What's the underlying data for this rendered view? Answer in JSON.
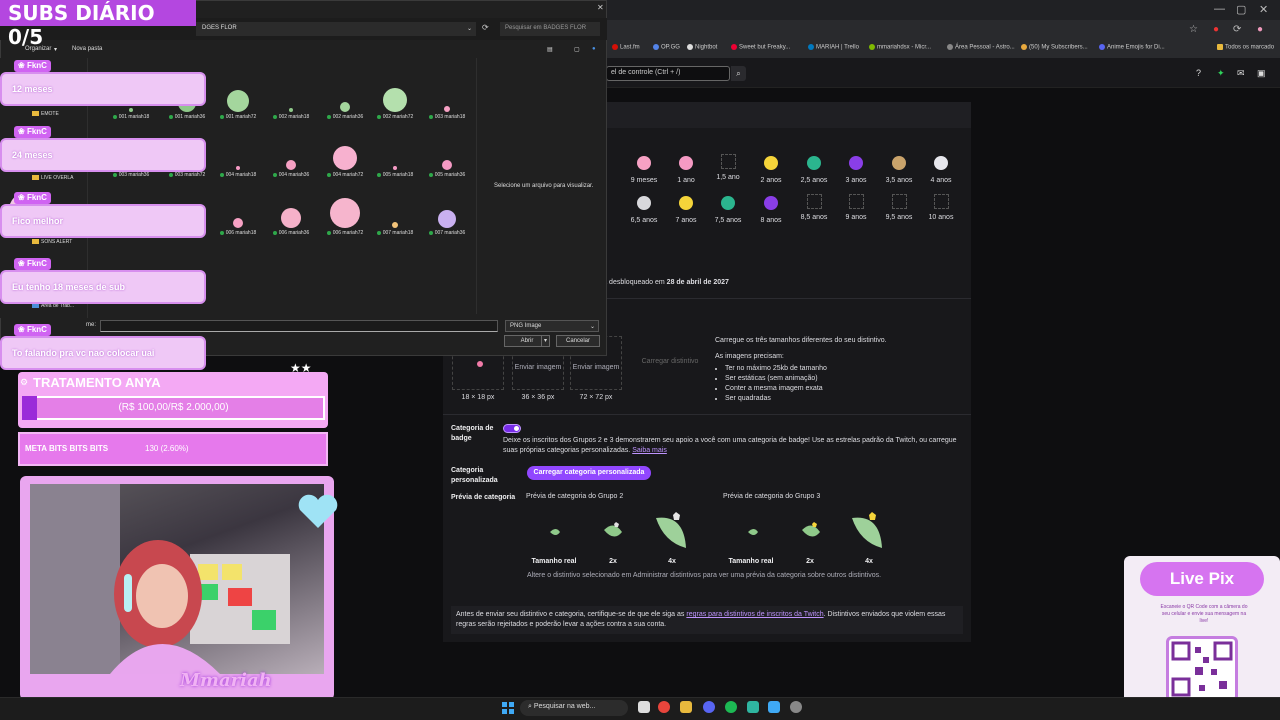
{
  "browser": {
    "bookmarks": [
      "Last.fm",
      "OP.GG",
      "Nightbot",
      "Sweet but Freaky...",
      "MARIAH | Trello",
      "mmariahdsx - Micr...",
      "Área Pessoal - Astro...",
      "(50) My Subscribers...",
      "Anime Emojis for Di...",
      "Todos os marcado"
    ]
  },
  "twitch": {
    "search_placeholder": "el de controle (Ctrl + /)",
    "badges_row1": [
      "9 meses",
      "1 ano",
      "1,5 ano",
      "2 anos",
      "2,5 anos",
      "3 anos",
      "3,5 anos",
      "4 anos"
    ],
    "badges_row2": [
      "6,5 anos",
      "7 anos",
      "7,5 anos",
      "8 anos",
      "8,5 anos",
      "9 anos",
      "9,5 anos",
      "10 anos"
    ],
    "unlock_prefix": "erá desbloqueado em",
    "unlock_date": "28 de abril de 2027",
    "upload_slots": [
      {
        "label": "",
        "size": "18 × 18 px"
      },
      {
        "label": "Enviar imagem",
        "size": "36 × 36 px"
      },
      {
        "label": "Enviar imagem",
        "size": "72 × 72 px"
      }
    ],
    "upload_badge_btn": "Carregar distintivo",
    "requirements": {
      "title": "Carregue os três tamanhos diferentes do seu distintivo.",
      "subtitle": "As imagens precisam:",
      "items": [
        "Ter no máximo 25kb de tamanho",
        "Ser estáticas (sem animação)",
        "Conter a mesma imagem exata",
        "Ser quadradas"
      ]
    },
    "category_label": "Categoria de badge",
    "category_desc": "Deixe os inscritos dos Grupos 2 e 3 demonstrarem seu apoio a você com uma categoria de badge! Use as estrelas padrão da Twitch, ou carregue suas próprias categorias personalizadas.",
    "category_link": "Saiba mais",
    "custom_label": "Categoria personalizada",
    "custom_btn": "Carregar categoria personalizada",
    "preview_label": "Prévia de categoria",
    "preview_group2": "Prévia de categoria do Grupo 2",
    "preview_group3": "Prévia de categoria do Grupo 3",
    "preview_sizes": [
      "Tamanho real",
      "2x",
      "4x",
      "Tamanho real",
      "2x",
      "4x"
    ],
    "preview_footer": "Altere o distintivo selecionado em Administrar distintivos para ver uma prévia da categoria sobre outros distintivos.",
    "note_before": "Antes de enviar seu distintivo e categoria, certifique-se de que ele siga as",
    "note_link": "regras para distintivos de inscritos da Twitch",
    "note_after": ". Distintivos enviados que violem essas regras serão rejeitados e poderão levar a ações contra a sua conta."
  },
  "dialog": {
    "path": "DGES FLOR",
    "search_placeholder": "Pesquisar em BADGES FLOR",
    "organize": "Organizar",
    "new_folder": "Nova pasta",
    "sidebar": [
      "EMOTE",
      "LIVE OVERLA",
      "SONS ALERT",
      "Área de Trab..."
    ],
    "files": [
      "001 mariah18",
      "001 mariah36",
      "001 mariah72",
      "002 mariah18",
      "002 mariah36",
      "002 mariah72",
      "003 mariah18",
      "003 mariah36",
      "003 mariah72",
      "004 mariah18",
      "004 mariah36",
      "004 mariah72",
      "005 mariah18",
      "005 mariah36",
      "006 mariah18",
      "006 mariah36",
      "006 mariah72",
      "007 mariah18",
      "007 mariah36",
      "007 mariah72"
    ],
    "preview_hint": "Selecione um arquivo para visualizar.",
    "filename_label": "me:",
    "filetype": "PNG Image",
    "open_btn": "Abrir",
    "cancel_btn": "Cancelar"
  },
  "overlay": {
    "subs_title": "SUBS DIÁRIO 0/5",
    "chat": [
      {
        "user": "FknC",
        "msg": "12 meses"
      },
      {
        "user": "FknC",
        "msg": "24 meses"
      },
      {
        "user": "FknC",
        "msg": "Fico melhor"
      },
      {
        "user": "FknC",
        "msg": "Eu tenho 18 meses de sub"
      },
      {
        "user": "FknC",
        "msg": "To falando pra vc nao colocar uai"
      }
    ],
    "goal_title": "TRATAMENTO ANYA",
    "goal_value": "(R$ 100,00/R$ 2.000,00)",
    "goal_fraction": 0.05,
    "meta_label": "META BITS BITS BITS",
    "meta_value": "130 (2.60%)",
    "cam_name": "Mmariah",
    "pix_title": "Live Pix",
    "pix_text": "Escaneie o QR Code com a câmera do seu celular e envie sua mensagem na live!"
  },
  "taskbar": {
    "search": "Pesquisar na web..."
  }
}
